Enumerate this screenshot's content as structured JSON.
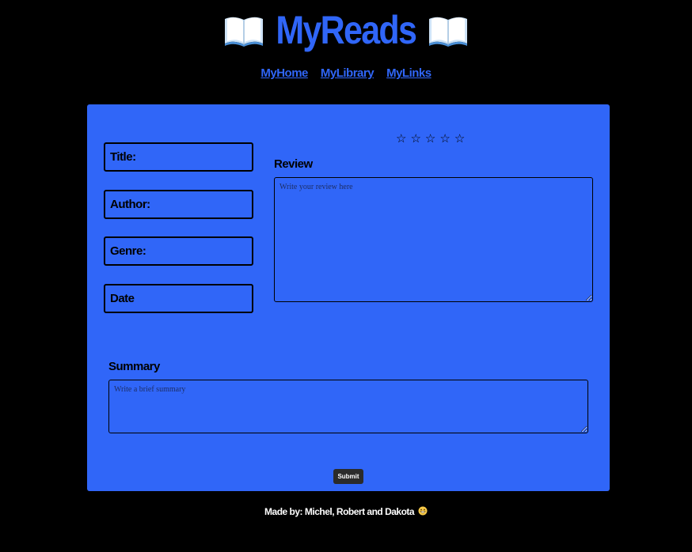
{
  "app": {
    "title": "MyReads",
    "left_icon": "open-book-icon",
    "right_icon": "open-book-icon",
    "accent_color": "#3066f8",
    "background_color": "#000000"
  },
  "nav": {
    "items": [
      {
        "label": "MyHome"
      },
      {
        "label": "MyLibrary"
      },
      {
        "label": "MyLinks"
      }
    ]
  },
  "form": {
    "fields": {
      "title": "Title:",
      "author": "Author:",
      "genre": "Genre:",
      "date": "Date"
    },
    "rating": {
      "stars": [
        "☆",
        "☆",
        "☆",
        "☆",
        "☆"
      ],
      "value": 0,
      "max": 5
    },
    "review": {
      "label": "Review",
      "placeholder": "Write your review here"
    },
    "summary": {
      "label": "Summary",
      "placeholder": "Write a brief summary"
    },
    "submit_label": "Submit"
  },
  "footer": {
    "text": "Made by: Michel, Robert and Dakota",
    "emoji": "grinning-face-icon"
  }
}
